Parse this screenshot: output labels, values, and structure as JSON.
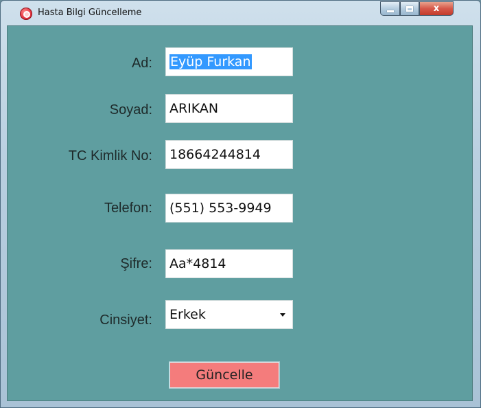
{
  "window": {
    "title": "Hasta Bilgi Güncelleme",
    "controls": {
      "minimize_icon": "minimize-icon",
      "maximize_icon": "maximize-icon",
      "close_icon": "close-icon"
    },
    "close_glyph": "x"
  },
  "form": {
    "ad": {
      "label": "Ad:",
      "value": "Eyüp Furkan"
    },
    "soyad": {
      "label": "Soyad:",
      "value": "ARIKAN"
    },
    "tc": {
      "label": "TC Kimlik No:",
      "value": "18664244814"
    },
    "telefon": {
      "label": "Telefon:",
      "value": "(551) 553-9949"
    },
    "sifre": {
      "label": "Şifre:",
      "value": "Aa*4814"
    },
    "cinsiyet": {
      "label": "Cinsiyet:",
      "selected": "Erkek"
    },
    "submit_label": "Güncelle"
  },
  "colors": {
    "client_bg": "#5f9ea0",
    "button_bg": "#f47c7c",
    "selection": "#3399ff"
  }
}
